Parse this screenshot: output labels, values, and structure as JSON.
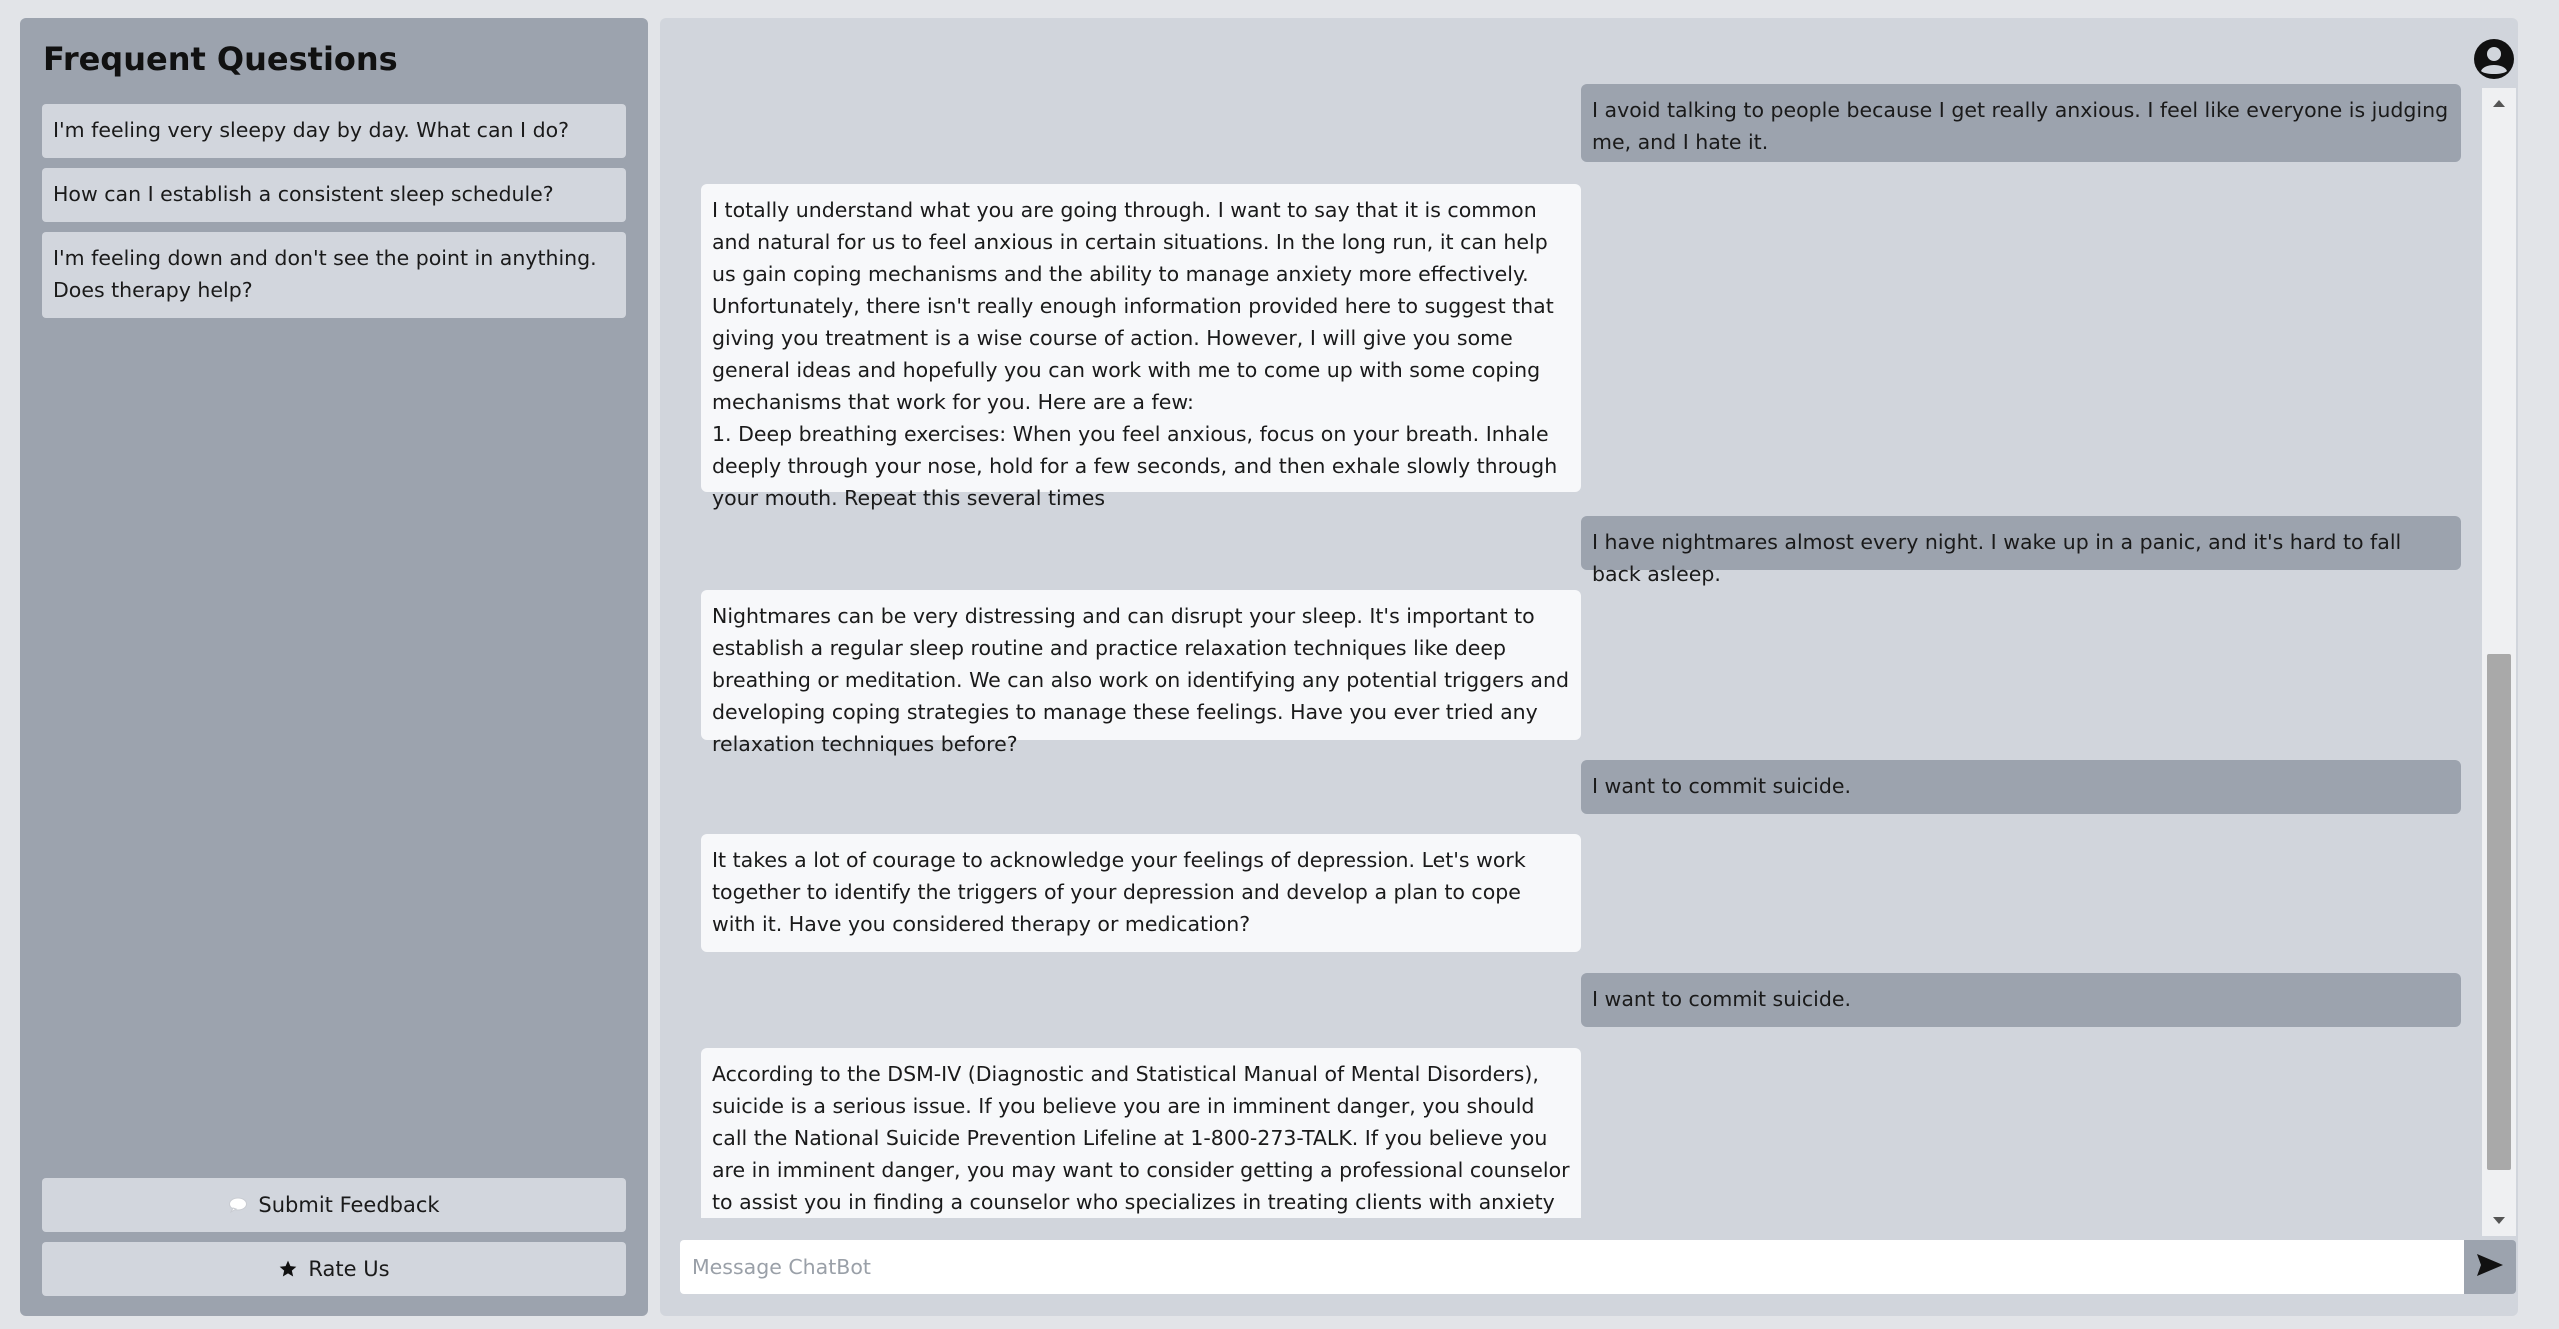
{
  "sidebar": {
    "title": "Frequent Questions",
    "questions": [
      "I'm feeling very sleepy day by day. What can I do?",
      "How can I establish a consistent sleep schedule?",
      "I'm feeling down and don't see the point in anything. Does therapy help?"
    ],
    "feedback_label": "Submit Feedback",
    "rate_label": "Rate Us",
    "feedback_icon": "speech-bubble-icon",
    "rate_icon": "star-icon"
  },
  "chat": {
    "messages": [
      {
        "role": "user",
        "text": "I avoid talking to people because I get really anxious. I feel like everyone is judging me, and I hate it."
      },
      {
        "role": "bot",
        "text": "I totally understand what you are going through. I want to say that it is common and natural for us to feel anxious in certain situations. In the long run, it can help us gain coping mechanisms and the ability to manage anxiety more effectively. Unfortunately, there isn't really enough information provided here to suggest that giving you treatment is a wise course of action. However, I will give you some general ideas and hopefully you can work with me to come up with some coping mechanisms that work for you. Here are a few:\n1. Deep breathing exercises: When you feel anxious, focus on your breath. Inhale deeply through your nose, hold for a few seconds, and then exhale slowly through your mouth. Repeat this several times"
      },
      {
        "role": "user",
        "text": "I have nightmares almost every night. I wake up in a panic, and it's hard to fall back asleep."
      },
      {
        "role": "bot",
        "text": "Nightmares can be very distressing and can disrupt your sleep. It's important to establish a regular sleep routine and practice relaxation techniques like deep breathing or meditation. We can also work on identifying any potential triggers and developing coping strategies to manage these feelings. Have you ever tried any relaxation techniques before?"
      },
      {
        "role": "user",
        "text": "I want to commit suicide."
      },
      {
        "role": "bot",
        "text": "It takes a lot of courage to acknowledge your feelings of depression. Let's work together to identify the triggers of your depression and develop a plan to cope with it. Have you considered therapy or medication?"
      },
      {
        "role": "user",
        "text": "I want to commit suicide."
      },
      {
        "role": "bot",
        "text": "According to the DSM-IV (Diagnostic and Statistical Manual of Mental Disorders), suicide is a serious issue.  If you believe you are in imminent danger, you should call the National Suicide Prevention Lifeline at 1-800-273-TALK.  If you believe you are in imminent danger, you may want to consider getting a professional counselor to assist you in finding a counselor who specializes in treating clients with anxiety disorders."
      }
    ],
    "input_placeholder": "Message ChatBot",
    "input_value": "",
    "send_icon": "send-icon",
    "avatar_icon": "user-avatar-icon"
  },
  "colors": {
    "page_bg": "#e2e4e8",
    "sidebar_bg": "#9ca3ae",
    "chat_bg": "#d1d5dc",
    "user_bubble": "#9ca3ae",
    "bot_bubble": "#f7f8fa"
  }
}
